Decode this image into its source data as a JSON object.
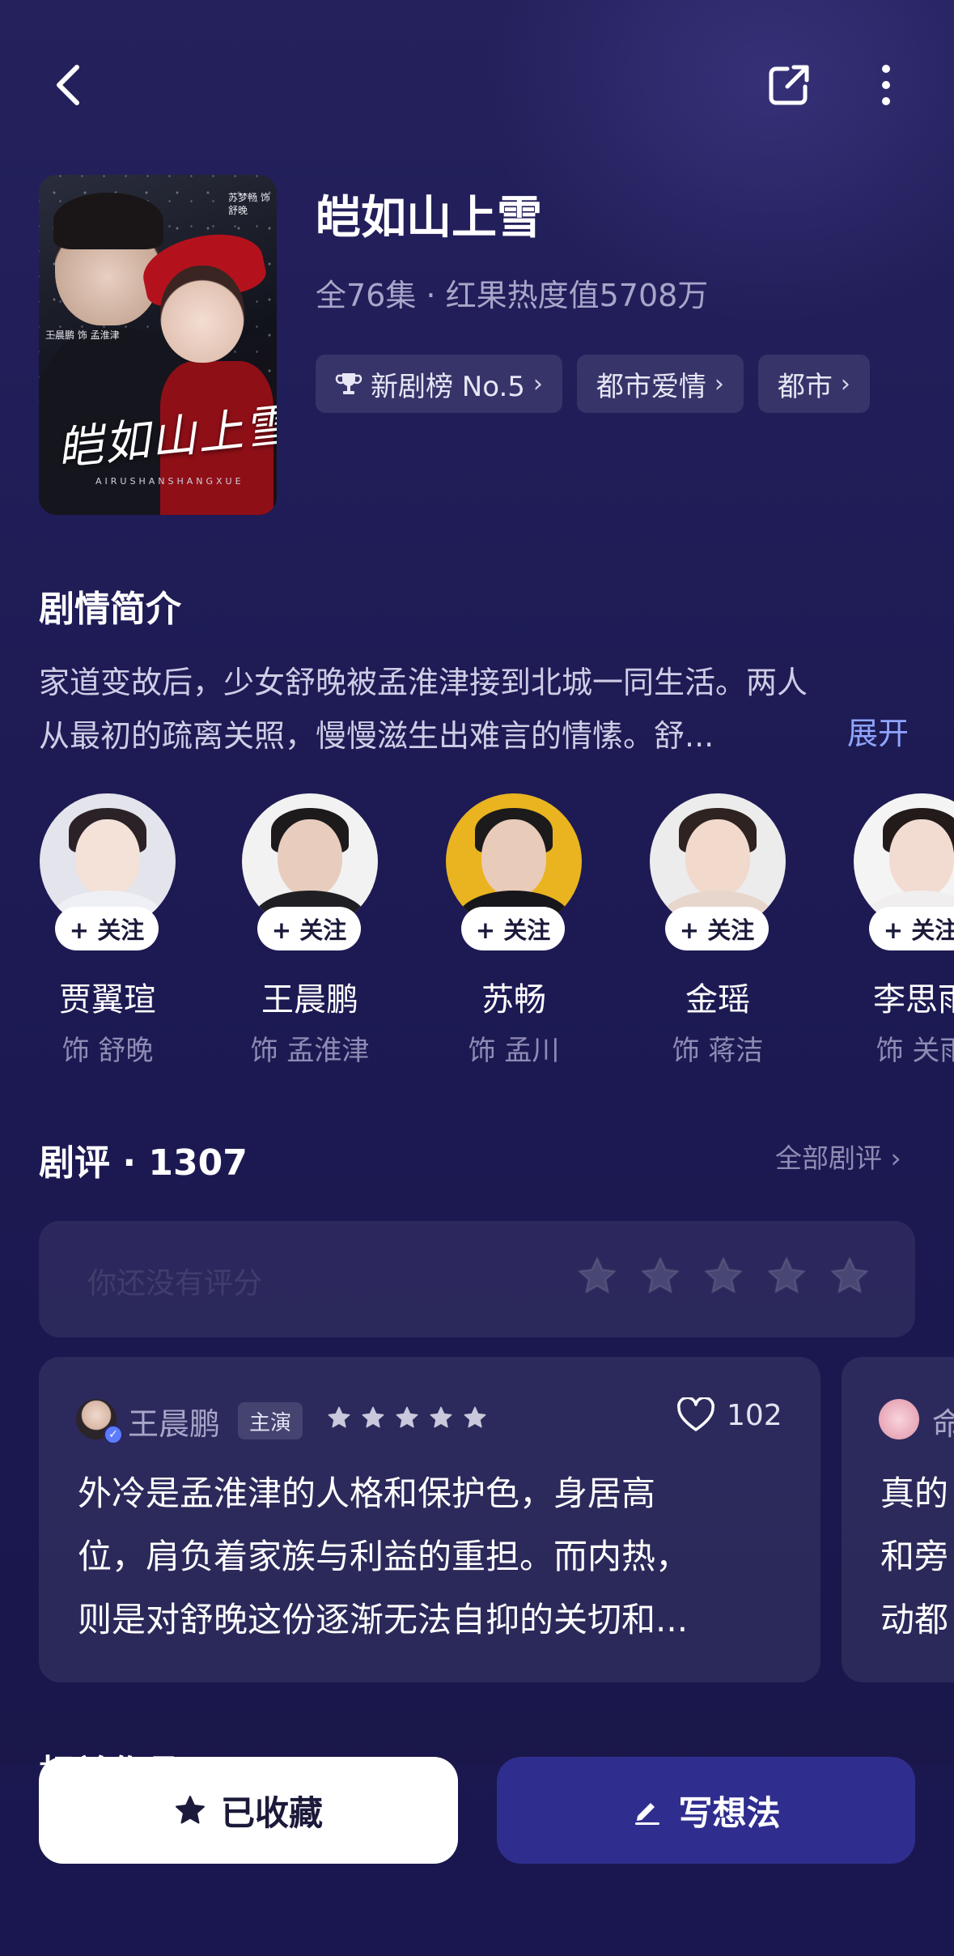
{
  "header": {
    "back_icon": "chevron-left-icon",
    "share_icon": "share-icon",
    "more_icon": "more-vertical-icon"
  },
  "drama": {
    "title": "皑如山上雪",
    "meta": "全76集 · 红果热度值5708万",
    "poster": {
      "title_art": "皑如山上雪",
      "subtitle_art": "AIRUSHANSHANGXUE",
      "credit_1": "苏梦畅 饰 舒晚",
      "credit_2": "王晨鹏 饰 孟淮津"
    },
    "tags": [
      {
        "label": "新剧榜 No.5",
        "icon": "trophy-icon"
      },
      {
        "label": "都市爱情"
      },
      {
        "label": "都市"
      }
    ]
  },
  "synopsis": {
    "heading": "剧情简介",
    "line1": "家道变故后，少女舒晚被孟淮津接到北城一同生活。两人",
    "line2": "从最初的疏离关照，慢慢滋生出难言的情愫。舒...",
    "expand_label": "展开"
  },
  "cast": {
    "follow_label": "+ 关注",
    "members": [
      {
        "name": "贾翼瑄",
        "role": "饰 舒晚"
      },
      {
        "name": "王晨鹏",
        "role": "饰 孟淮津"
      },
      {
        "name": "苏畅",
        "role": "饰 孟川"
      },
      {
        "name": "金瑶",
        "role": "饰 蒋洁"
      },
      {
        "name": "李思雨",
        "role": "饰 关雨"
      }
    ]
  },
  "reviews": {
    "heading": "剧评 · 1307",
    "all_label": "全部剧评 ›",
    "rating_hint": "你还没有评分",
    "rating_stars": 5,
    "items": [
      {
        "user": "王晨鹏",
        "badge": "主演",
        "stars": 5,
        "likes": "102",
        "line1": "外冷是孟淮津的人格和保护色，身居高",
        "line2": "位，肩负着家族与利益的重担。而内热，",
        "line3": "则是对舒晚这份逐渐无法自抑的关切和..."
      },
      {
        "user": "命",
        "line1": "真的",
        "line2": "和旁",
        "line3": "动都"
      }
    ]
  },
  "related_heading": "相关作品",
  "actions": {
    "collect_label": "已收藏",
    "collect_icon": "star-icon",
    "write_label": "写想法",
    "write_icon": "pencil-icon"
  },
  "colors": {
    "background": "#1d1a52",
    "accent_link": "#8fa6ff",
    "primary_button": "#2f2e8f",
    "verified": "#5b7cff"
  }
}
